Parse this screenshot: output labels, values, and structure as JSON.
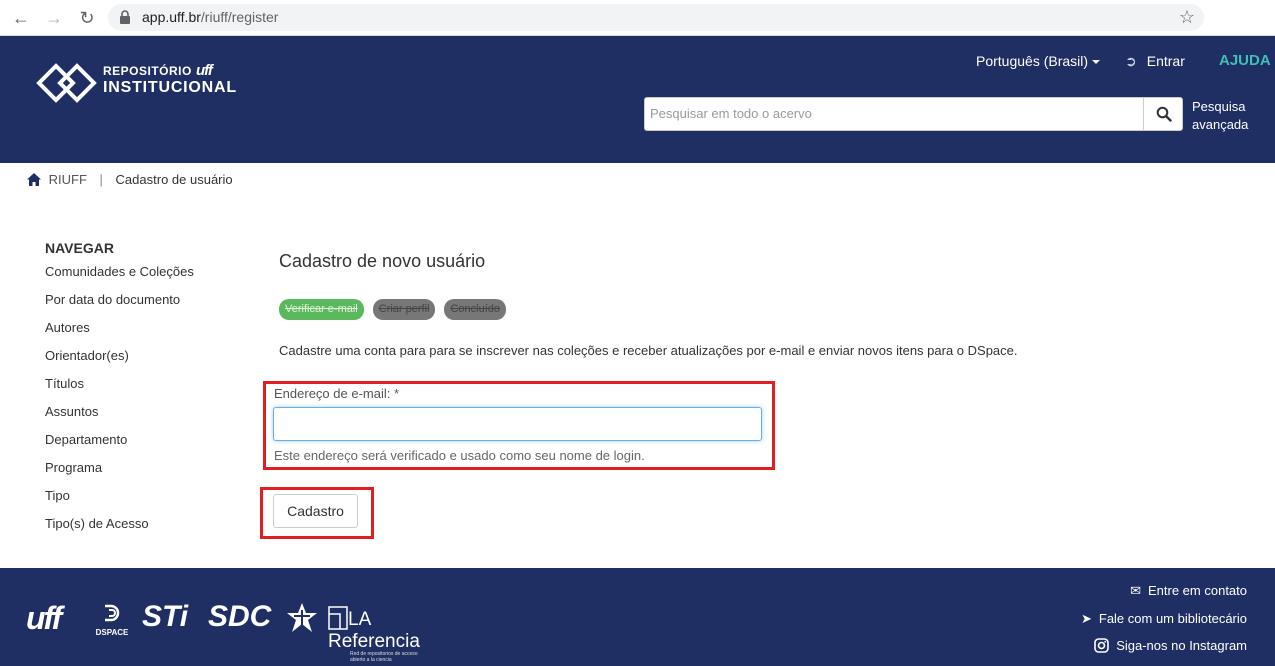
{
  "browser": {
    "url_host": "app.uff.br",
    "url_path": "/riuff/register"
  },
  "header": {
    "logo_line1": "REPOSITÓRIO",
    "logo_uff": "uff",
    "logo_line2": "INSTITUCIONAL",
    "language": "Português (Brasil)",
    "login": "Entrar",
    "help": "AJUDA",
    "search_placeholder": "Pesquisar em todo o acervo",
    "advanced_search_line1": "Pesquisa",
    "advanced_search_line2": "avançada"
  },
  "breadcrumb": {
    "home": "RIUFF",
    "separator": "|",
    "current": "Cadastro de usuário"
  },
  "sidebar": {
    "title": "NAVEGAR",
    "items": [
      "Comunidades e Coleções",
      "Por data do documento",
      "Autores",
      "Orientador(es)",
      "Títulos",
      "Assuntos",
      "Departamento",
      "Programa",
      "Tipo",
      "Tipo(s) de Acesso"
    ]
  },
  "main": {
    "title": "Cadastro de novo usuário",
    "steps": [
      "Verificar e-mail",
      "Criar perfil",
      "Concluído"
    ],
    "description": "Cadastre uma conta para para se inscrever nas coleções e receber atualizações por e-mail e enviar novos itens para o DSpace.",
    "email_label": "Endereço de e-mail: *",
    "email_value": "",
    "email_help": "Este endereço será verificado e usado como seu nome de login.",
    "submit_label": "Cadastro"
  },
  "footer": {
    "logo_uff": "uff",
    "logo_dspace": "DSPACE",
    "logo_sti": "STi",
    "logo_sdc": "SDC",
    "logo_la": "LA Referencia",
    "logo_la_sub": "Red de repositorios de acceso abierto a la ciencia",
    "links": [
      "Entre em contato",
      "Fale com um bibliotecário",
      "Siga-nos no Instagram"
    ]
  },
  "colors": {
    "header_bg": "#1f2e63",
    "help_accent": "#3fbfb5",
    "step_active": "#5cb85c",
    "step_inactive": "#777777",
    "highlight_red": "#e02020"
  }
}
